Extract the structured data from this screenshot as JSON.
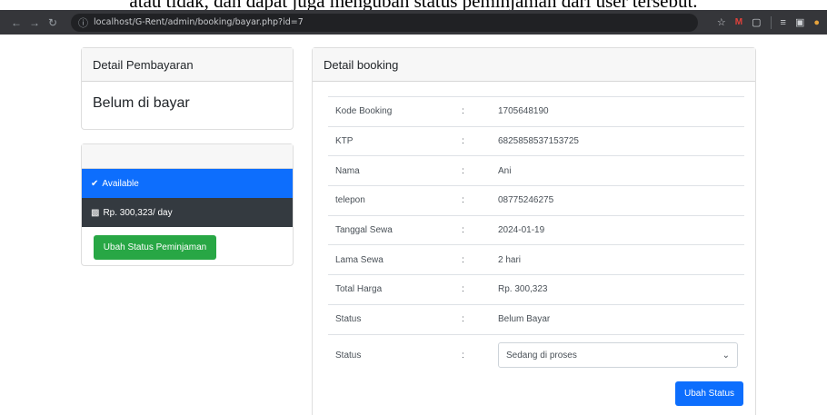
{
  "caption": "atau tidak, dan dapat juga mengubah status peminjaman dari user tersebut.",
  "browser": {
    "url": "localhost/G-Rent/admin/booking/bayar.php?id=7",
    "icons": [
      "back-icon",
      "forward-icon",
      "reload-icon",
      "info-icon",
      "star-icon",
      "extension-icon",
      "puzzle-icon",
      "playlist-icon",
      "sidepanel-icon",
      "avatar-icon"
    ]
  },
  "payment_card": {
    "title": "Detail Pembayaran",
    "status": "Belum di bayar"
  },
  "car_card": {
    "availability": "Available",
    "price": "Rp. 300,323/ day",
    "button": "Ubah Status Peminjaman"
  },
  "booking_card": {
    "title": "Detail booking",
    "rows": [
      {
        "label": "Kode Booking",
        "colon": ":",
        "value": "1705648190"
      },
      {
        "label": "KTP",
        "colon": ":",
        "value": "6825858537153725"
      },
      {
        "label": "Nama",
        "colon": ":",
        "value": "Ani"
      },
      {
        "label": "telepon",
        "colon": ":",
        "value": "08775246275"
      },
      {
        "label": "Tanggal Sewa",
        "colon": ":",
        "value": "2024-01-19"
      },
      {
        "label": "Lama Sewa",
        "colon": ":",
        "value": "2 hari"
      },
      {
        "label": "Total Harga",
        "colon": ":",
        "value": "Rp. 300,323"
      },
      {
        "label": "Status",
        "colon": ":",
        "value": "Belum Bayar"
      }
    ],
    "status_select": {
      "label": "Status",
      "colon": ":",
      "selected": "Sedang di proses"
    },
    "button": "Ubah Status"
  },
  "colors": {
    "primary": "#0d6efd",
    "success": "#28a745",
    "dark": "#343a40",
    "browser": "#35363a"
  }
}
